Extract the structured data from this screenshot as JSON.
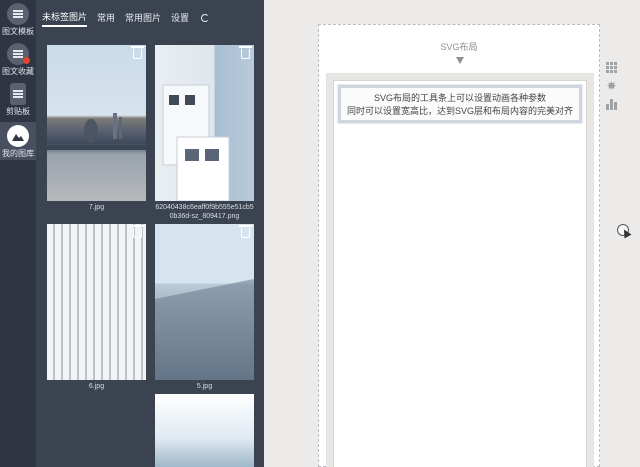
{
  "rail": {
    "items": [
      {
        "label": "图文模板",
        "icon": "template-icon"
      },
      {
        "label": "图文收藏",
        "icon": "favorite-icon"
      },
      {
        "label": "剪贴板",
        "icon": "clipboard-icon"
      },
      {
        "label": "我的图库",
        "icon": "gallery-icon"
      }
    ]
  },
  "panel": {
    "tabs": [
      "未标签图片",
      "常用",
      "常用图片",
      "设置"
    ],
    "images": [
      {
        "caption": "7.jpg"
      },
      {
        "caption": "62040438c6eaff0f9b555e51cb50b36d-sz_809417.png"
      },
      {
        "caption": "6.jpg"
      },
      {
        "caption": "5.jpg"
      },
      {
        "caption": ""
      }
    ]
  },
  "editor": {
    "title": "SVG布局",
    "notice_line1": "SVG布局的工具条上可以设置动画各种参数",
    "notice_line2": "同时可以设置宽高比，达到SVG层和布局内容的完美对齐"
  },
  "colors": {
    "rail_bg": "#2f3542",
    "panel_bg": "#3b4351",
    "accent_red": "#e3452e"
  }
}
